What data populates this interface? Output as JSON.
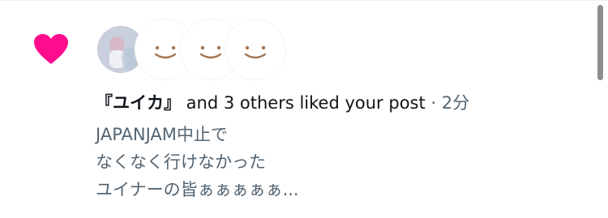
{
  "notification": {
    "type": "like",
    "accent_color": "#f91880",
    "icon": "heart-icon",
    "avatars": [
      {
        "kind": "photo"
      },
      {
        "kind": "smiley-placeholder"
      },
      {
        "kind": "smiley-placeholder"
      },
      {
        "kind": "smiley-placeholder"
      }
    ],
    "actor": "『ユイカ』",
    "action_text": " and 3 others liked your post",
    "separator": " · ",
    "time": "2分",
    "post_lines": [
      "JAPANJAM中止で",
      "なくなく行けなかった",
      "ユイナーの皆ぁぁぁぁぁ..."
    ]
  }
}
